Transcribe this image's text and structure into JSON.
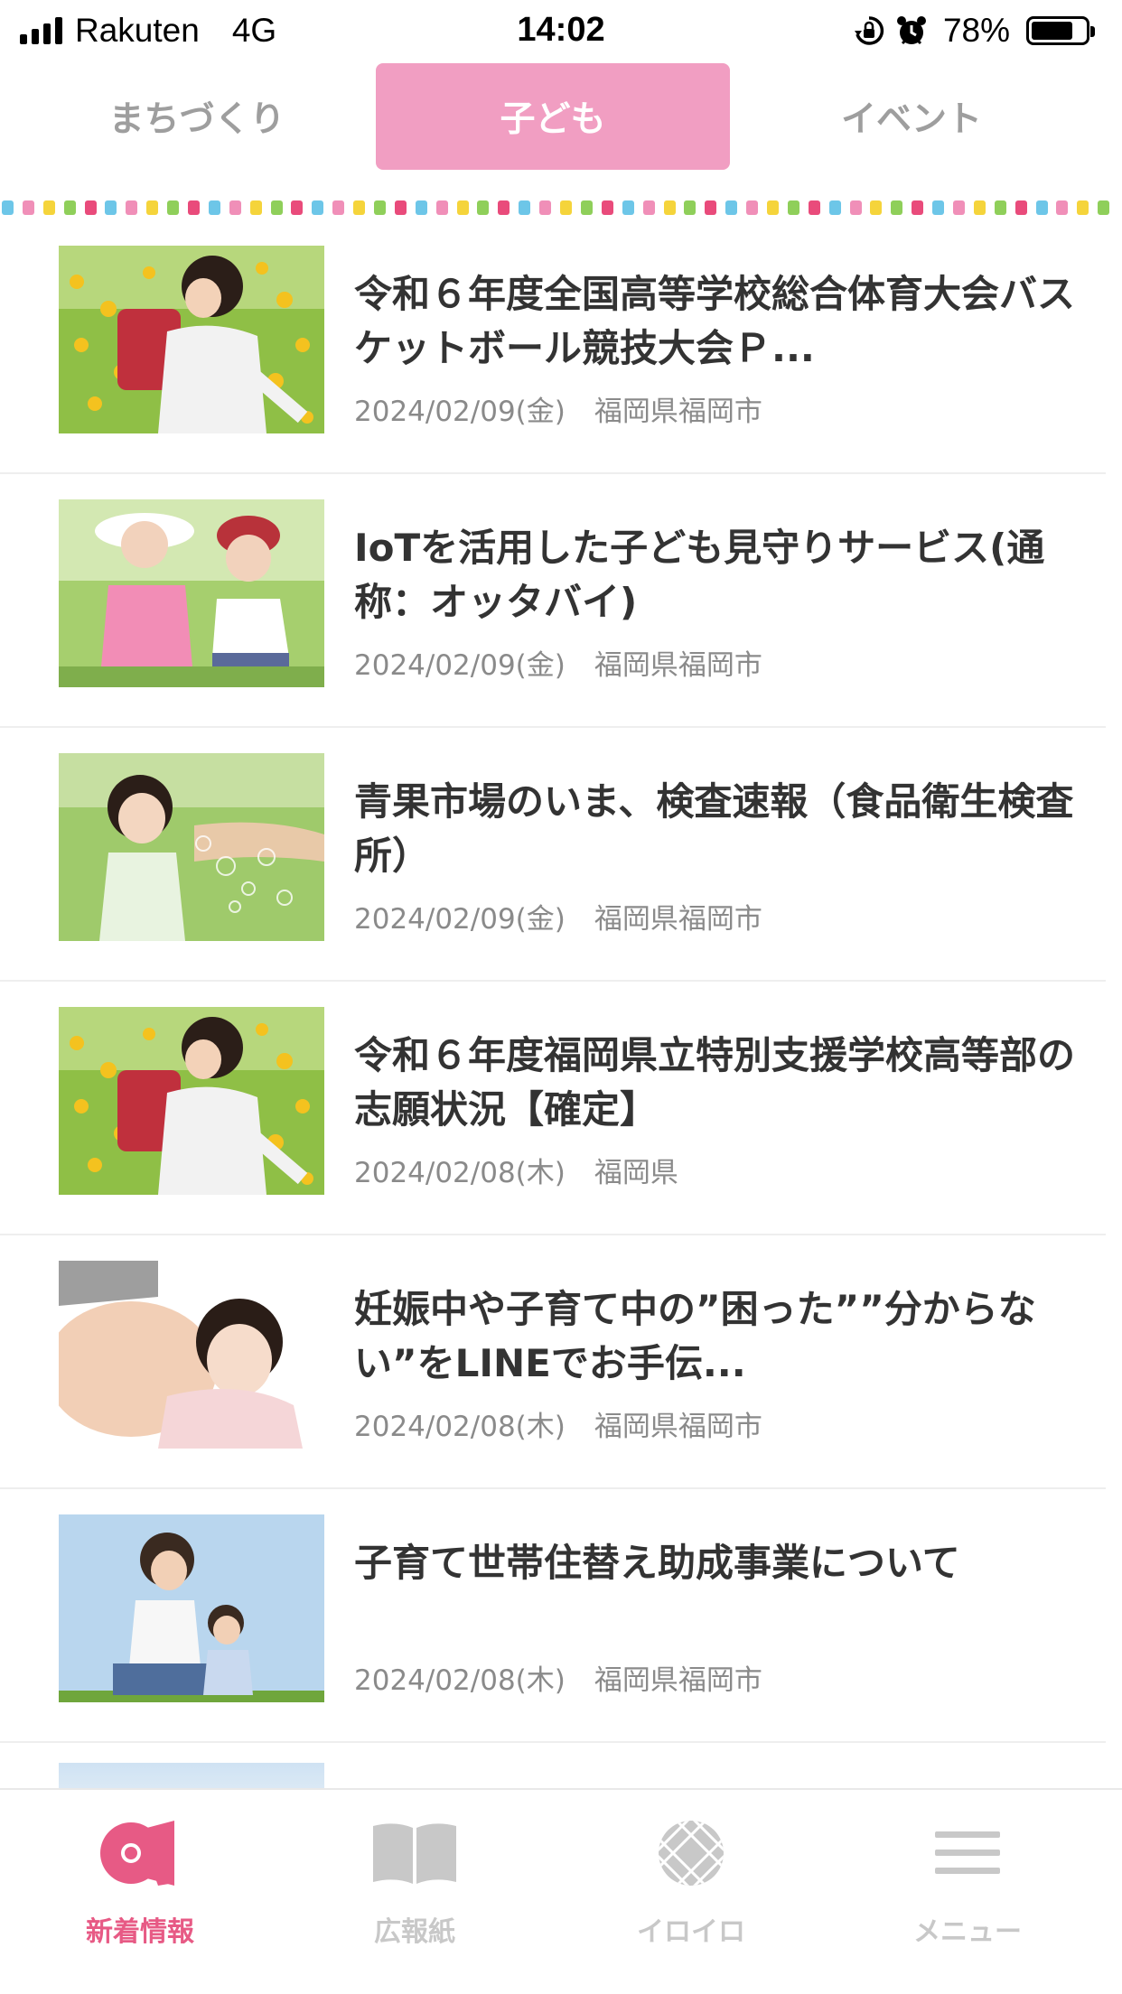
{
  "status_bar": {
    "carrier": "Rakuten",
    "network": "4G",
    "time": "14:02",
    "battery": "78%",
    "battery_level": 0.78,
    "icons": [
      "signal-icon",
      "rotation-lock-icon",
      "alarm-icon",
      "battery-icon"
    ]
  },
  "tabs": [
    {
      "label": "まちづくり",
      "active": false
    },
    {
      "label": "子ども",
      "active": true
    },
    {
      "label": "イベント",
      "active": false
    }
  ],
  "divider_colors": [
    "#6dc6e8",
    "#f08fb8",
    "#f5d43b",
    "#8fcf5a",
    "#e94b7b"
  ],
  "news": [
    {
      "title": "令和６年度全国高等学校総合体育大会バスケットボール競技大会Ｐ...",
      "date": "2024/02/09(金)",
      "region": "福岡県福岡市",
      "thumbnail": "girl-with-school-bag-photo"
    },
    {
      "title": "IoTを活用した子ども見守りサービス(通称：オッタバイ)",
      "date": "2024/02/09(金)",
      "region": "福岡県福岡市",
      "thumbnail": "two-children-in-hats-photo"
    },
    {
      "title": "青果市場のいま、検査速報（食品衛生検査所）",
      "date": "2024/02/09(金)",
      "region": "福岡県福岡市",
      "thumbnail": "girl-blowing-bubbles-photo"
    },
    {
      "title": "令和６年度福岡県立特別支援学校高等部の志願状況【確定】",
      "date": "2024/02/08(木)",
      "region": "福岡県",
      "thumbnail": "girl-with-school-bag-photo"
    },
    {
      "title": "妊娠中や子育て中の”困った””分からない”をLINEでお手伝...",
      "date": "2024/02/08(木)",
      "region": "福岡県福岡市",
      "thumbnail": "child-hugging-pregnant-belly-photo"
    },
    {
      "title": "子育て世帯住替え助成事業について",
      "date": "2024/02/08(木)",
      "region": "福岡県福岡市",
      "thumbnail": "mother-and-child-bubbles-photo"
    }
  ],
  "bottom_nav": [
    {
      "label": "新着情報",
      "icon": "megaphone-icon",
      "active": true
    },
    {
      "label": "広報紙",
      "icon": "open-book-icon",
      "active": false
    },
    {
      "label": "イロイロ",
      "icon": "lattice-ball-icon",
      "active": false
    },
    {
      "label": "メニュー",
      "icon": "hamburger-menu-icon",
      "active": false
    }
  ],
  "colors": {
    "accent_pink": "#f19ec2",
    "active_nav": "#e75a85",
    "inactive": "#c8c8c8"
  }
}
